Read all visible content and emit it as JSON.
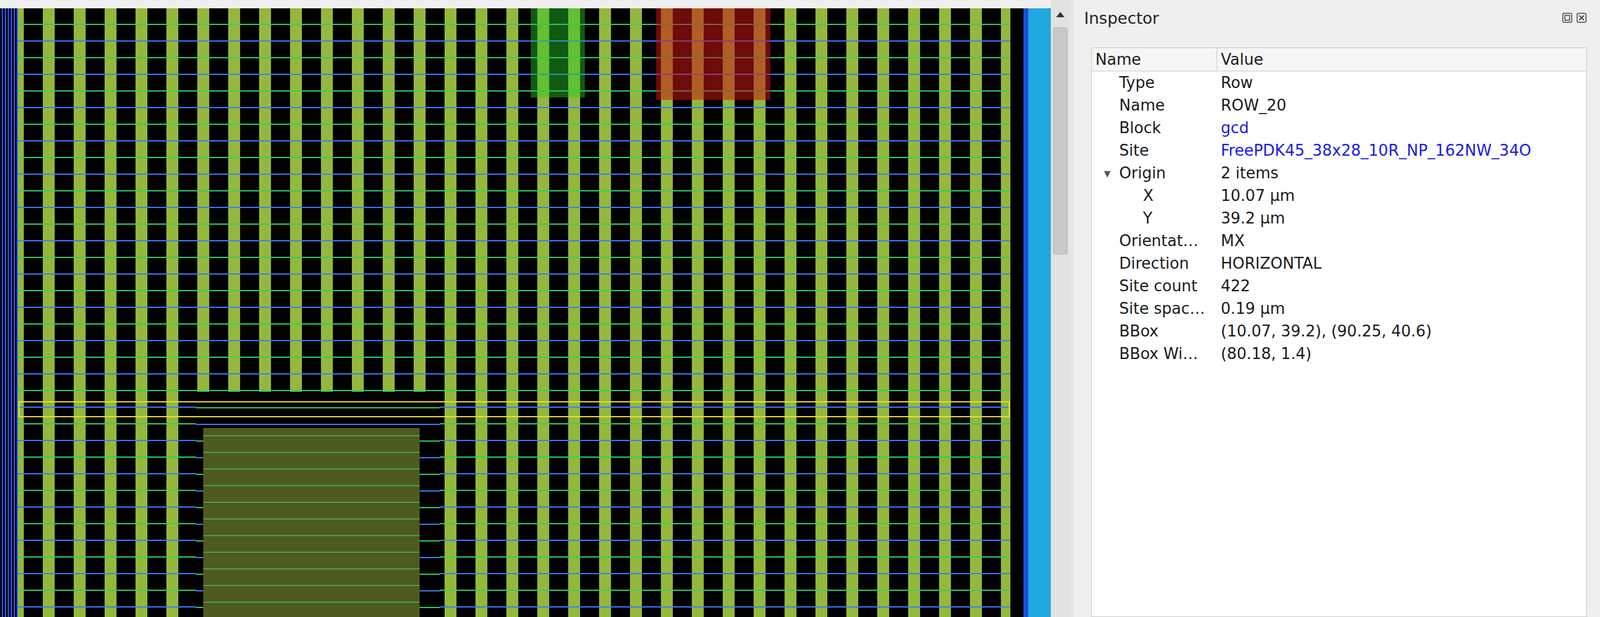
{
  "inspector": {
    "title": "Inspector",
    "columns": [
      "Name",
      "Value"
    ],
    "properties": [
      {
        "name": "Type",
        "value": "Row",
        "kind": "text"
      },
      {
        "name": "Name",
        "value": "ROW_20",
        "kind": "text"
      },
      {
        "name": "Block",
        "value": "gcd",
        "kind": "link"
      },
      {
        "name": "Site",
        "value": "FreePDK45_38x28_10R_NP_162NW_34O",
        "kind": "link"
      },
      {
        "name": "Origin",
        "value": "2 items",
        "kind": "group",
        "toggle": "▾",
        "expanded": true,
        "children": [
          {
            "name": "X",
            "value": "10.07 µm"
          },
          {
            "name": "Y",
            "value": "39.2 µm"
          }
        ]
      },
      {
        "name": "Orientat…",
        "value": "MX",
        "kind": "text"
      },
      {
        "name": "Direction",
        "value": "HORIZONTAL",
        "kind": "text"
      },
      {
        "name": "Site count",
        "value": "422",
        "kind": "text"
      },
      {
        "name": "Site spac…",
        "value": "0.19 µm",
        "kind": "text"
      },
      {
        "name": "BBox",
        "value": "(10.07, 39.2), (90.25, 40.6)",
        "kind": "text"
      },
      {
        "name": "BBox Wi…",
        "value": "(80.18, 1.4)",
        "kind": "text"
      }
    ]
  }
}
